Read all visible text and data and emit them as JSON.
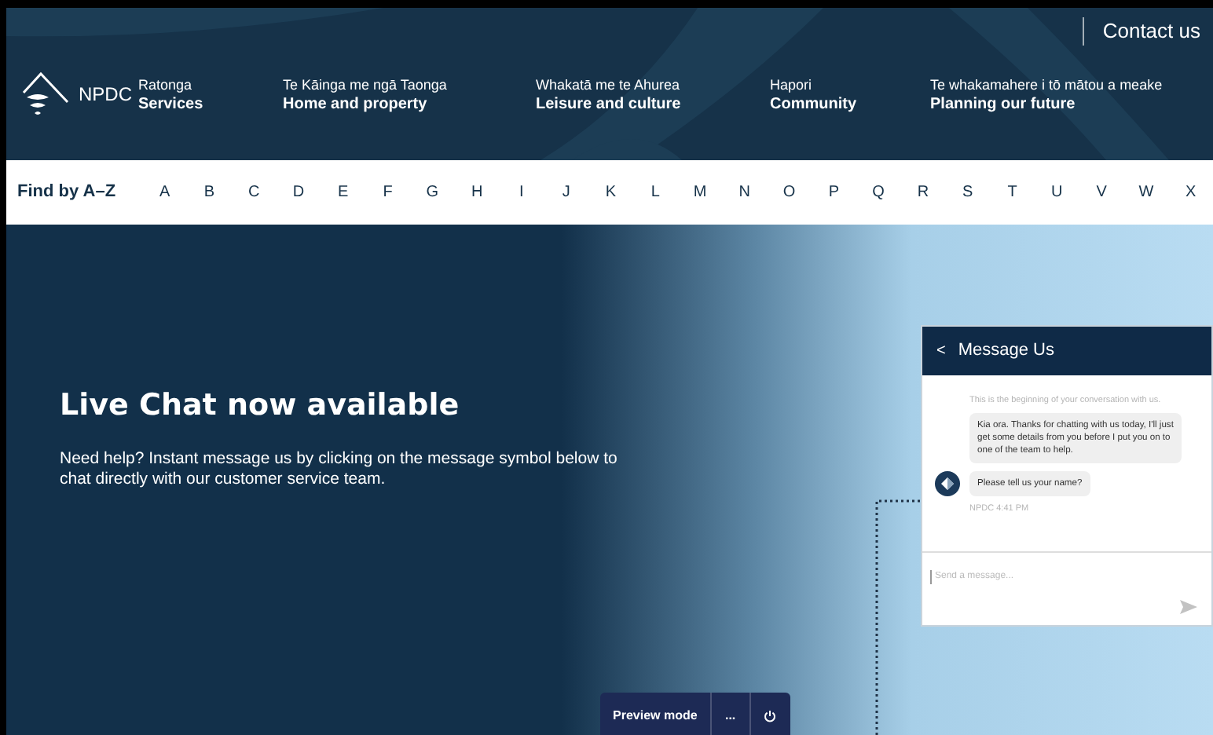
{
  "header": {
    "contact_link": "Contact us",
    "logo_text": "NPDC",
    "nav": [
      {
        "maori": "Ratonga",
        "english": "Services"
      },
      {
        "maori": "Te Kāinga me ngā Taonga",
        "english": "Home and property"
      },
      {
        "maori": "Whakatā me te Ahurea",
        "english": "Leisure and culture"
      },
      {
        "maori": "Hapori",
        "english": "Community"
      },
      {
        "maori": "Te whakamahere i tō mātou a meake",
        "english": "Planning our future"
      }
    ]
  },
  "az": {
    "label": "Find by A–Z",
    "letters": [
      "A",
      "B",
      "C",
      "D",
      "E",
      "F",
      "G",
      "H",
      "I",
      "J",
      "K",
      "L",
      "M",
      "N",
      "O",
      "P",
      "Q",
      "R",
      "S",
      "T",
      "U",
      "V",
      "W",
      "X"
    ]
  },
  "hero": {
    "title": "Live Chat now available",
    "body": "Need help? Instant message us by clicking on the message symbol below to chat directly with our customer service team."
  },
  "chat": {
    "back": "<",
    "title": "Message Us",
    "intro": "This is the beginning of your conversation with us.",
    "messages": [
      "Kia ora. Thanks for chatting with us today, I'll just get some details from you before I put you on to one of the team to help.",
      "Please tell us your name?"
    ],
    "meta": "NPDC 4:41 PM",
    "placeholder": "Send a message..."
  },
  "preview_bar": {
    "label": "Preview mode",
    "more": "..."
  }
}
